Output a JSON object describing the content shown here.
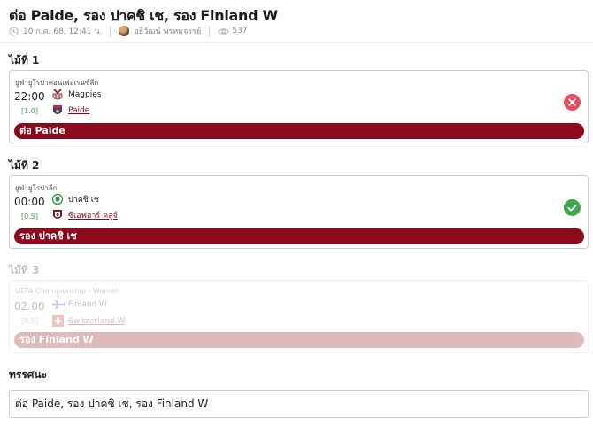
{
  "header": {
    "title": "ต่อ Paide, รอง ปาคชิ เช, รอง Finland W",
    "date": "10 ก.ค. 68, 12:41 น.",
    "author": "อธิวัฒน์ พรหมจรรย์",
    "views": "537"
  },
  "picks": [
    {
      "step_label": "ไม้ที่ 1",
      "league": "ยูฟ่ายูโรปาคอนเฟอเรนซ์ลีก",
      "time": "22:00",
      "handicap": "[1.0]",
      "home": "Magpies",
      "away": "Paide",
      "pick": "ต่อ Paide",
      "result": "lose"
    },
    {
      "step_label": "ไม้ที่ 2",
      "league": "ยูฟ่ายูโรปาลีก",
      "time": "00:00",
      "handicap": "[0.5]",
      "home": "ปาคชิ เช",
      "away": "ซีเอฟอาร์ คลูจ์",
      "pick": "รอง ปาคชิ เช",
      "result": "win"
    },
    {
      "step_label": "ไม้ที่ 3",
      "league": "UEFA Championship - Women",
      "time": "02:00",
      "handicap": "[0.5]",
      "home": "Finland W",
      "away": "Switzerland W",
      "pick": "รอง Finland W",
      "result": "pending"
    }
  ],
  "summary": {
    "label": "ทรรศนะ",
    "text": "ต่อ Paide, รอง ปาคชิ เช, รอง Finland W"
  },
  "colors": {
    "accent": "#8b0a1e",
    "lose": "#e0505f",
    "win": "#3ba84a",
    "handicap": "#3ea05e"
  }
}
